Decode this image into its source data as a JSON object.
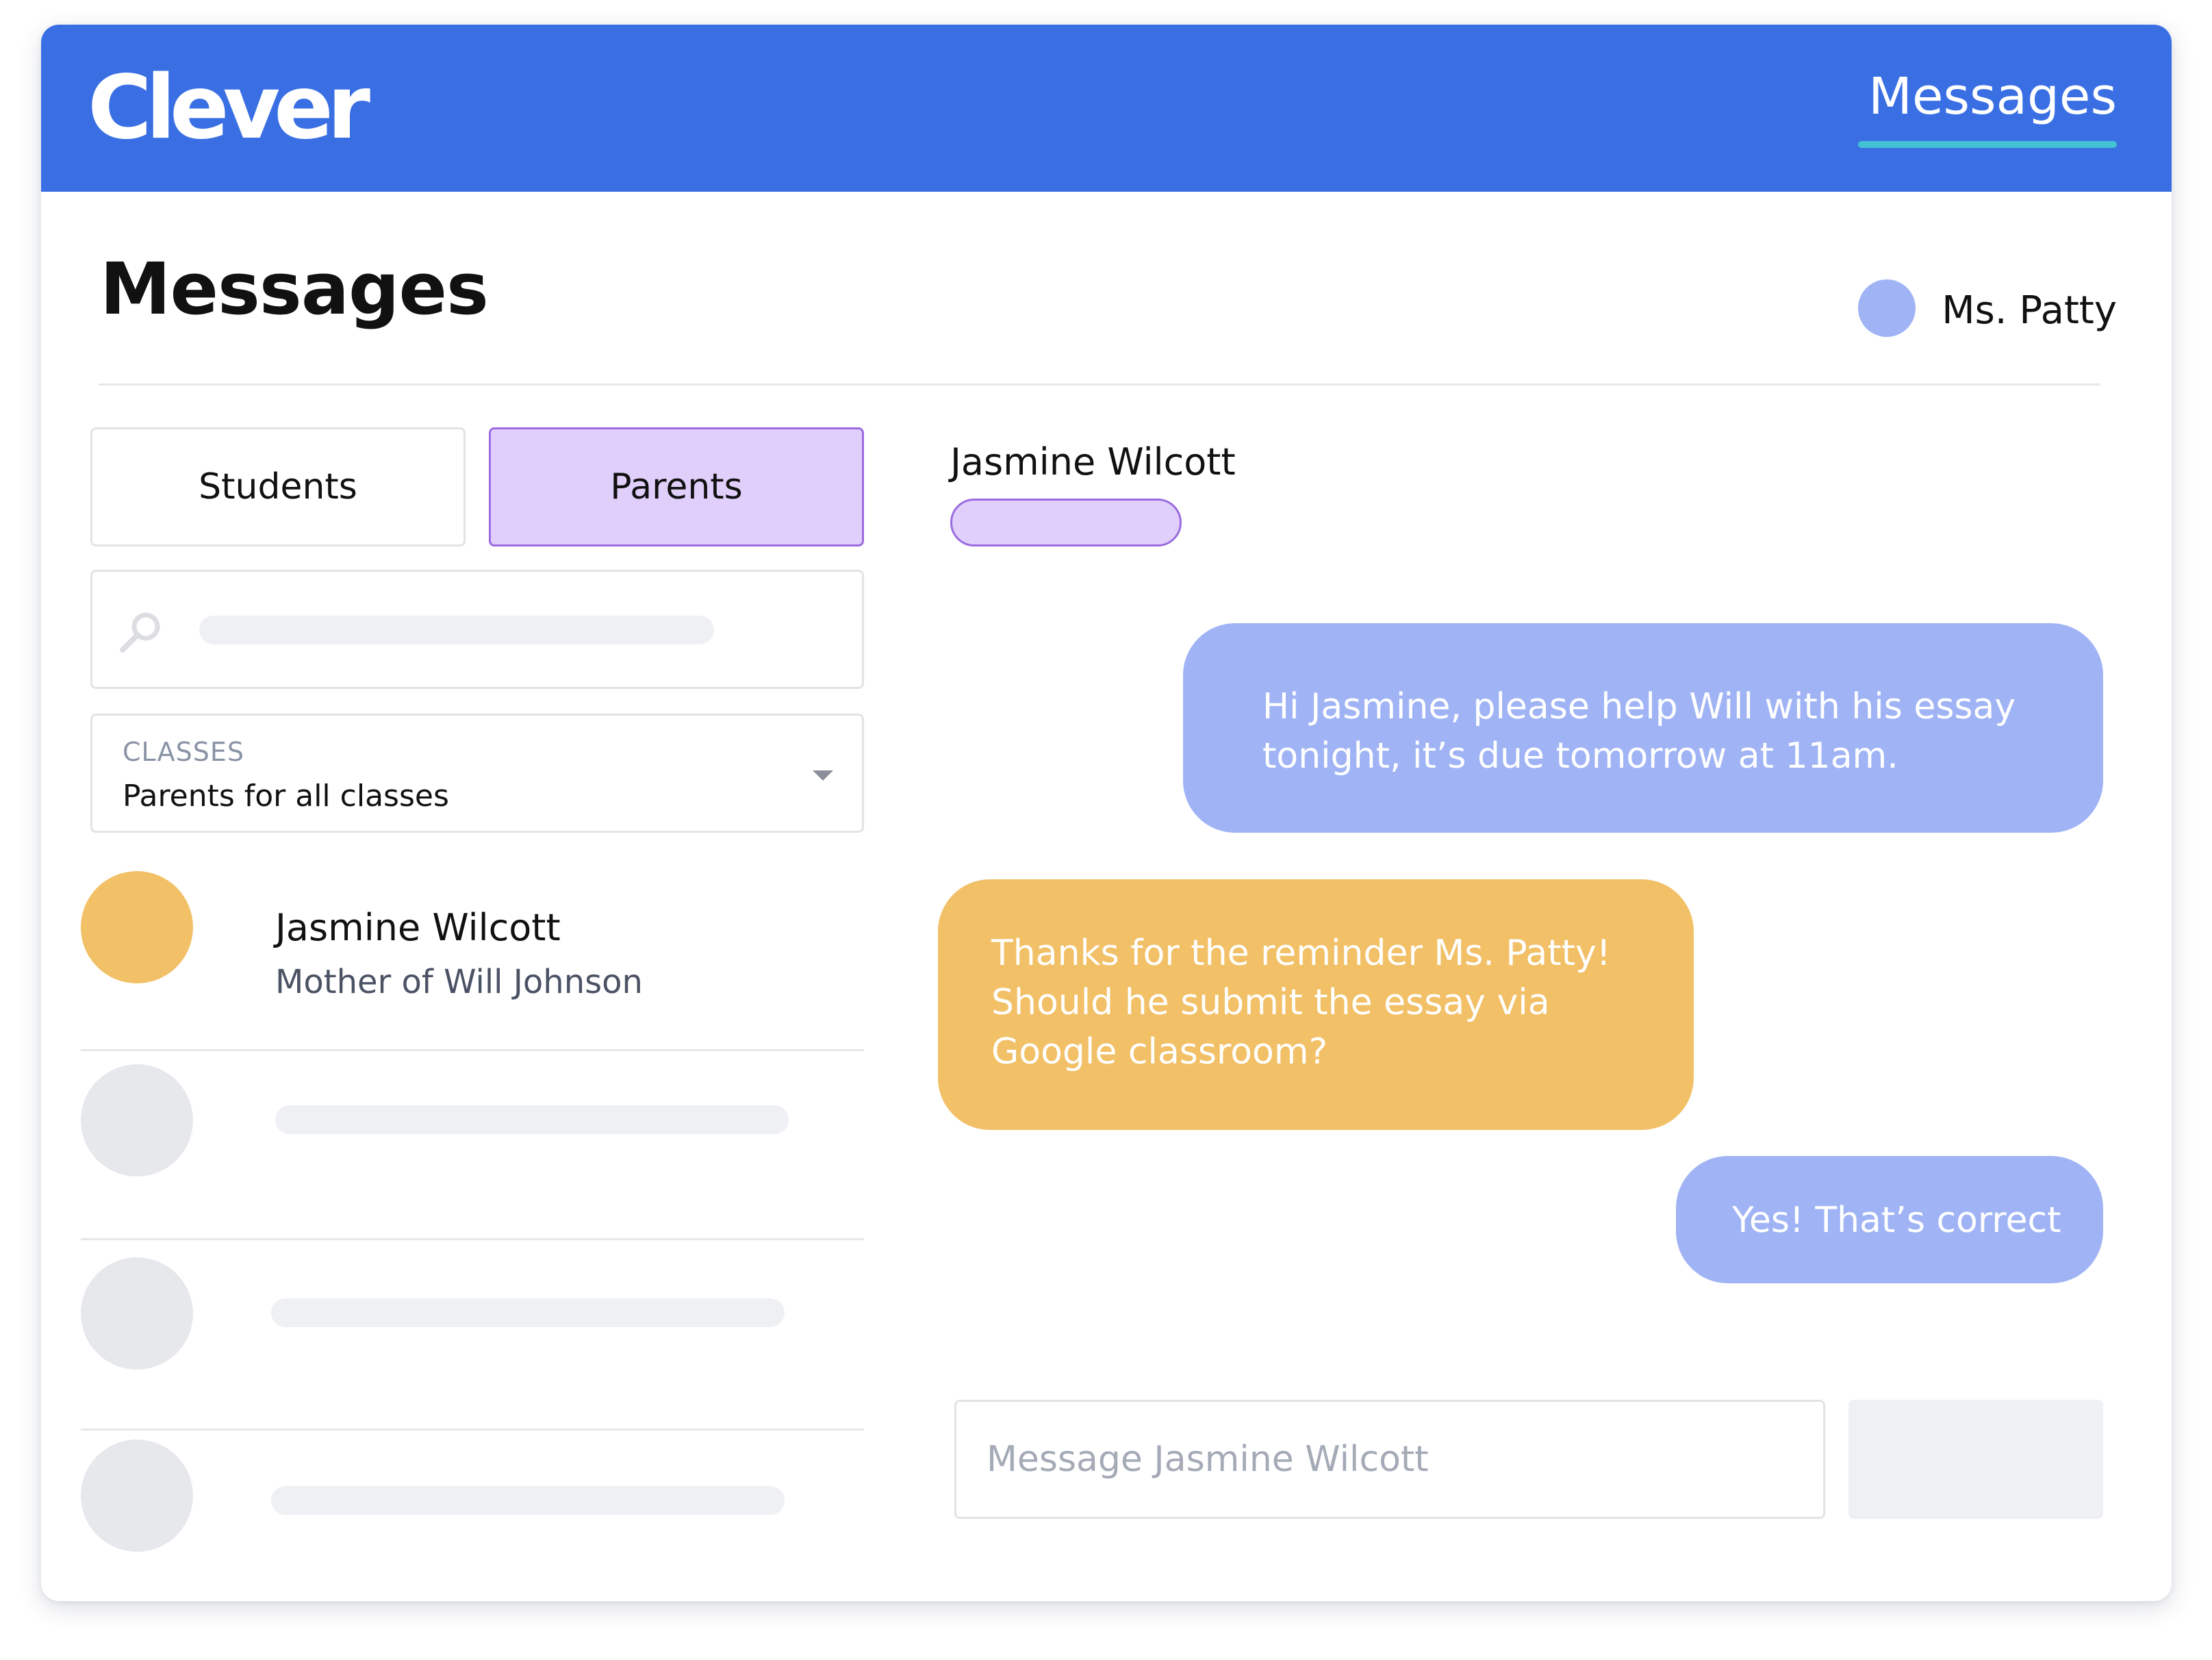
{
  "app": {
    "logo": "Clever",
    "nav_item": "Messages"
  },
  "header": {
    "title": "Messages",
    "user_name": "Ms. Patty"
  },
  "tabs": [
    {
      "label": "Students",
      "active": false
    },
    {
      "label": "Parents",
      "active": true
    }
  ],
  "filter": {
    "label": "CLASSES",
    "value": "Parents for all classes"
  },
  "contacts": [
    {
      "name": "Jasmine Wilcott",
      "subtitle": "Mother of Will Johnson"
    }
  ],
  "conversation": {
    "recipient": "Jasmine Wilcott",
    "messages": [
      {
        "from": "teacher",
        "text": "Hi Jasmine, please help Will with his essay tonight, it’s due tomorrow at 11am."
      },
      {
        "from": "parent",
        "text": "Thanks for the reminder Ms. Patty! Should he submit the essay via Google classroom?"
      },
      {
        "from": "teacher",
        "text": "Yes! That’s correct"
      }
    ],
    "input_placeholder": "Message Jasmine Wilcott"
  },
  "colors": {
    "brand_blue": "#3a6fe4",
    "nav_underline": "#43c2d3",
    "teacher_bubble": "#a0b4f5",
    "parent_bubble": "#f2c066",
    "active_tab": "#e0cffb",
    "active_tab_border": "#9b6ce0",
    "placeholder_gray": "#eef0f3"
  }
}
